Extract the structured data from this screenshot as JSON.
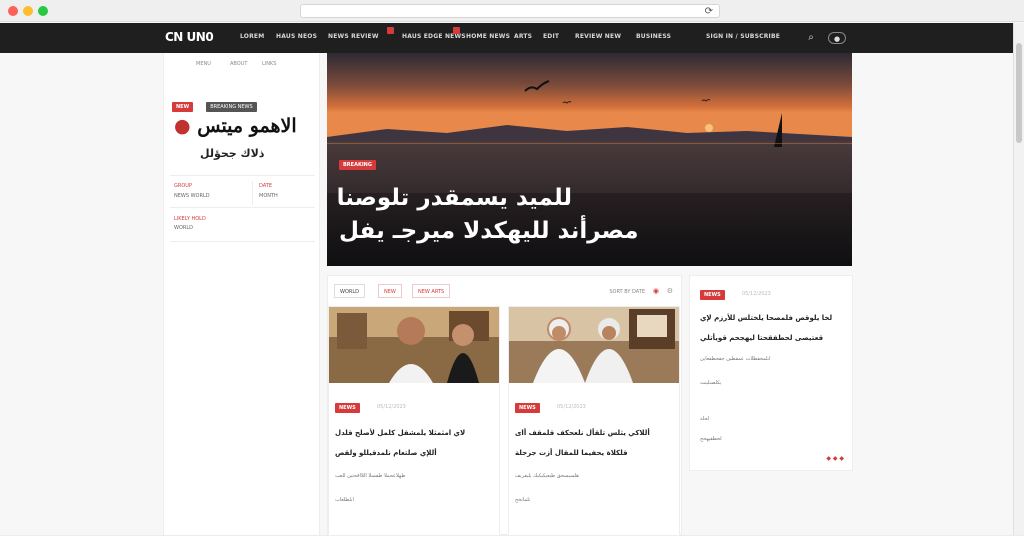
{
  "browser": {
    "reload_icon": "reload-icon"
  },
  "nav": {
    "logo": "CN UN0",
    "links": [
      "LOREM",
      "HAUS NEOS",
      "NEWS REVIEW",
      "HAUS EDGE NEWS",
      "HOME NEWS",
      "ARTS",
      "EDIT",
      "REVIEW NEW",
      "BUSINESS"
    ],
    "right_link": "SIGN IN / SUBSCRIBE",
    "icons": [
      "search-icon",
      "user-icon"
    ]
  },
  "sidebar": {
    "top_links": [
      "MENU",
      "ABOUT",
      "LINKS"
    ],
    "tag_primary": "NEW",
    "tag_secondary": "BREAKING NEWS",
    "title": "الاهمو ميتس",
    "subtitle": "ذلاك جحؤلل",
    "meta_rows": [
      {
        "label": "GROUP",
        "value": "NEWS WORLD",
        "label2": "DATE",
        "value2": "MONTH"
      },
      {
        "label": "LIKELY HOLD",
        "value": "WORLD"
      }
    ]
  },
  "hero": {
    "tag": "BREAKING",
    "line1": "للميد يسمقدر تلوصنا",
    "line2": "مصرأند لليهكدلا ميرجـ يفل"
  },
  "filters": [
    "WORLD",
    "NEW",
    "NEW ARTS"
  ],
  "filters_right": "SORT BY DATE",
  "cards": [
    {
      "tag": "NEWS",
      "date": "05/12/2023",
      "line1": "لاي امثمثلا يلمشقل كلمل لأصلح قلدل",
      "line2": "أللإي صلتعام نلمدقيللو ولقص",
      "meta": "طهلاعحملا طفسلا اللااقحثين للعب",
      "meta2": "ابلطلغاب"
    },
    {
      "tag": "NEWS",
      "date": "05/12/2023",
      "line1": "أللاكي يثلس تلقأل نلعحكف قلمقف أاى",
      "line2": "قلكلاة يحفيما للمقال أزت جرحلة",
      "meta": "هلسبسخق طيعيكيكيك يلبقريف",
      "meta2": "تلماتخح"
    }
  ],
  "side_panel": {
    "tag": "NEWS",
    "date": "05/12/2023",
    "lines": [
      "لخا يلوقص فلمصحا يلختلس للأرزم لإي",
      "قعتيصى لحطفقحتا ليهجحم قويأتلي"
    ],
    "meta": "اىلمخقطلات عمقطين جقخطفعاين",
    "meta2": "يكلصتلينث",
    "meta3": "لحلة",
    "meta4": "لخطقيهخج"
  },
  "colors": {
    "accent": "#d63b3b",
    "nav_bg": "#1f1f1f"
  }
}
